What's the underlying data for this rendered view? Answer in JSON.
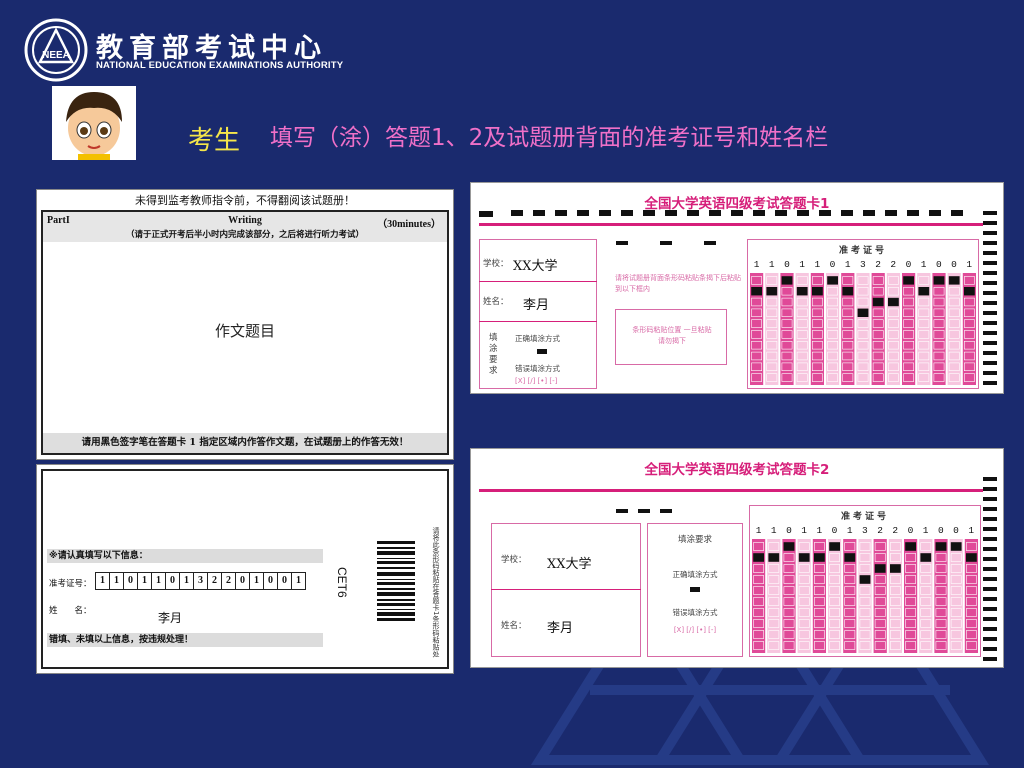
{
  "header": {
    "org_cn": "教育部考试中心",
    "org_en": "NATIONAL EDUCATION EXAMINATIONS AUTHORITY",
    "logo_letters": "NEEA",
    "who": "考生",
    "instruction": "填写（涂）答题1、2及试题册背面的准考证号和姓名栏"
  },
  "booklet": {
    "notice": "未得到监考教师指令前，不得翻阅该试题册！",
    "part": "PartI",
    "section": "Writing",
    "time": "（30minutes）",
    "sub_instruction": "（请于正式开考后半小时内完成该部分，之后将进行听力考试）",
    "essay_placeholder": "作文题目",
    "footer": "请用黑色签字笔在答题卡 1 指定区域内作答作文题，在试题册上的作答无效！",
    "back": {
      "confirm_note": "※请认真填写以下信息：",
      "id_label": "准考证号：",
      "id_digits": [
        "1",
        "1",
        "0",
        "1",
        "1",
        "0",
        "1",
        "3",
        "2",
        "2",
        "0",
        "1",
        "0",
        "0",
        "1"
      ],
      "name_label": "姓　　名：",
      "name_value": "李月",
      "warning": "错填、未填以上信息，按违规处理！",
      "code": "CET6",
      "vertical_note": "请将此条形码粘贴在答题卡1条形码粘贴处"
    }
  },
  "card1": {
    "title": "全国大学英语四级考试答题卡1",
    "school_label": "学校：",
    "school_value": "XX大学",
    "name_label": "姓名：",
    "name_value": "李月",
    "fill_label": "填涂要求",
    "correct_label": "正确填涂方式",
    "wrong_label": "错误填涂方式",
    "wrong_marks": "[X] [/] [•] [-]",
    "sticker_note1": "请将试题册背面条形码粘贴条揭下后粘贴到以下框内",
    "sticker_note2": "条形码粘贴位置 一旦粘贴请勿揭下",
    "exam_no_label": "准考证号",
    "exam_no": [
      "1",
      "1",
      "0",
      "1",
      "1",
      "0",
      "1",
      "3",
      "2",
      "2",
      "0",
      "1",
      "0",
      "0",
      "1"
    ]
  },
  "card2": {
    "title": "全国大学英语四级考试答题卡2",
    "school_label": "学校：",
    "school_value": "XX大学",
    "name_label": "姓名：",
    "name_value": "李月",
    "fill_label": "填涂要求",
    "correct_label": "正确填涂方式",
    "wrong_label": "错误填涂方式",
    "wrong_marks": "[X] [/] [•] [-]",
    "exam_no_label": "准考证号",
    "exam_no": [
      "1",
      "1",
      "0",
      "1",
      "1",
      "0",
      "1",
      "3",
      "2",
      "2",
      "0",
      "1",
      "0",
      "0",
      "1"
    ]
  },
  "colors": {
    "background": "#1a2a6e",
    "card_pink": "#d61f7a",
    "who_yellow": "#f5e64a",
    "instruction_pink": "#f070c8"
  }
}
